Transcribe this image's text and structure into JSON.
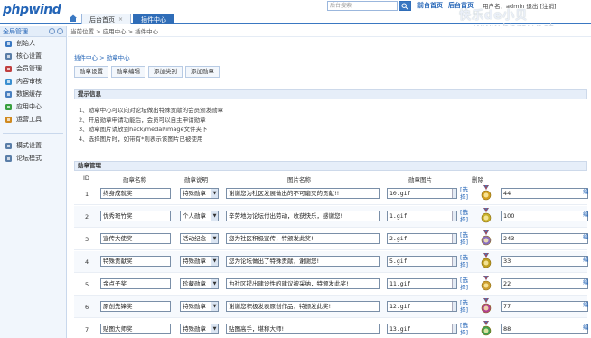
{
  "app": {
    "logo_text": "phpwind",
    "top_tabs": [
      {
        "label": "后台首页",
        "active": false
      },
      {
        "label": "插件中心",
        "active": true
      }
    ],
    "tab_close": "×",
    "search_placeholder": "后台搜索",
    "top_links": [
      "前台首页",
      "后台首页"
    ],
    "nav_row2": [
      "|",
      "用户名：admin",
      "|",
      "[退出]"
    ],
    "user_info": "用户名：admin 退出 [注销]",
    "watermark": "快乐de小贝",
    "watermark_url": "www.bbray.net"
  },
  "sidebar": {
    "title": "全局管理",
    "items": [
      {
        "label": "创始人",
        "icon": "user-icon",
        "color": "#3a78c2"
      },
      {
        "label": "核心设置",
        "icon": "gear-icon",
        "color": "#5a7ea8"
      },
      {
        "label": "会员管理",
        "icon": "members-icon",
        "color": "#c04040"
      },
      {
        "label": "内容审核",
        "icon": "chat-icon",
        "color": "#3a8fd0"
      },
      {
        "label": "数据缓存",
        "icon": "database-icon",
        "color": "#4a80c0"
      },
      {
        "label": "应用中心",
        "icon": "app-icon",
        "color": "#3aa040"
      },
      {
        "label": "运营工具",
        "icon": "tools-icon",
        "color": "#d08a20"
      }
    ],
    "items2": [
      {
        "label": "模式设置",
        "icon": "mode-icon",
        "color": "#5a7ea8"
      },
      {
        "label": "论坛模式",
        "icon": "forum-icon",
        "color": "#5a7ea8"
      }
    ]
  },
  "main": {
    "breadcrumb": "当前位置 > 应用中心 > 插件中心",
    "subcrumb": "插件中心 > 勋章中心",
    "action_buttons": [
      "勋章设置",
      "勋章编辑",
      "添加类别",
      "添加勋章"
    ],
    "tips_title": "提示信息",
    "tips": [
      "1、勋章中心可以向对论坛做出特殊贡献的会员颁发勋章",
      "2、开启勋章申请功能后，会员可以自主申请勋章",
      "3、勋章图片请放到hack/medal/image文件夹下",
      "4、选择图片时，如带有*则表示该图片已被使用"
    ],
    "table_title": "勋章管理",
    "columns": [
      "ID",
      "勋章名称",
      "勋章说明",
      "图片名称",
      "勋章图片",
      "删除"
    ],
    "select_label": "[选\n择]",
    "rows": [
      {
        "id": "1",
        "name": "终身成就奖",
        "type": "特殊勋章",
        "desc": "谢谢您为社区发展做出的不可磨灭的贡献!!",
        "img": "10.gif",
        "num": "44",
        "medal_color": "#d4a020"
      },
      {
        "id": "2",
        "name": "优秀斑竹奖",
        "type": "个人勋章",
        "desc": "辛劳地为论坛付出劳动，收获快乐，感谢您!",
        "img": "1.gif",
        "num": "100",
        "medal_color": "#c7b12a"
      },
      {
        "id": "3",
        "name": "宣传大使奖",
        "type": "活动纪念",
        "desc": "您为社区积极宣传，特颁发此奖!",
        "img": "2.gif",
        "num": "243",
        "medal_color": "#8a6fc0"
      },
      {
        "id": "4",
        "name": "特殊贡献奖",
        "type": "特殊勋章",
        "desc": "您为论坛做出了特殊贡献，谢谢您!",
        "img": "5.gif",
        "num": "33",
        "medal_color": "#c0a020"
      },
      {
        "id": "5",
        "name": "金点子奖",
        "type": "珍藏勋章",
        "desc": "为社区提出建设性的建议被采纳，特颁发此奖!",
        "img": "11.gif",
        "num": "22",
        "medal_color": "#d0a030"
      },
      {
        "id": "6",
        "name": "原创先锋奖",
        "type": "特殊勋章",
        "desc": "谢谢您积极发表原创作品，特颁发此奖!",
        "img": "12.gif",
        "num": "77",
        "medal_color": "#b04090"
      },
      {
        "id": "7",
        "name": "贴图大师奖",
        "type": "特殊勋章",
        "desc": "贴图高手，堪称大师!",
        "img": "13.gif",
        "num": "88",
        "medal_color": "#40a050"
      }
    ],
    "edit_label": "编"
  }
}
